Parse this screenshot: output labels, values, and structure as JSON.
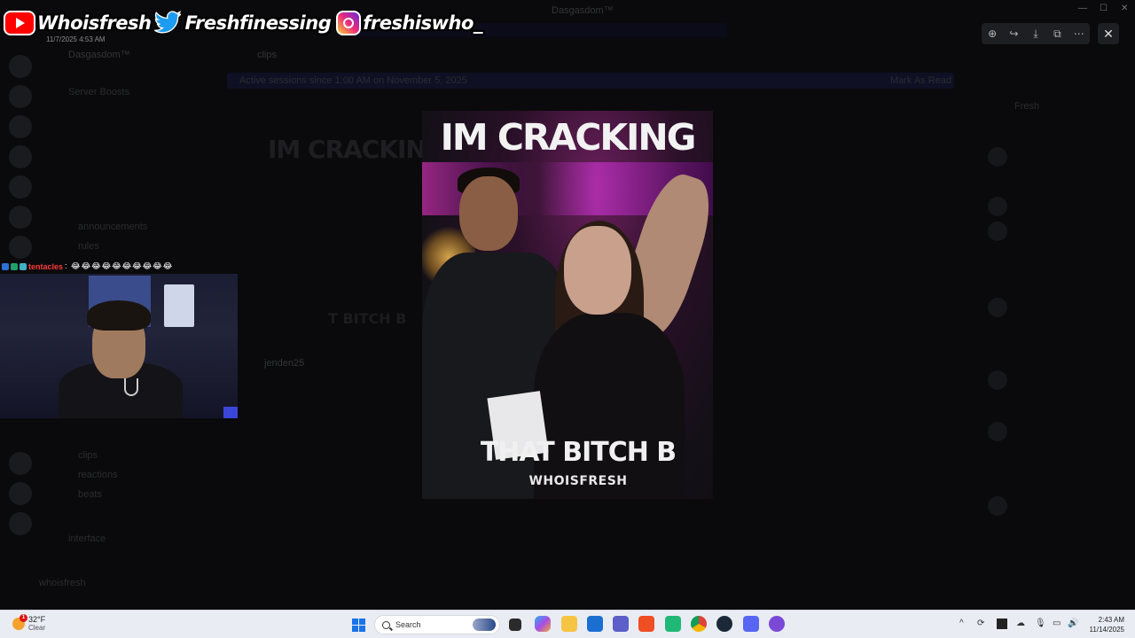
{
  "social_header": {
    "youtube_handle": "Whoisfresh",
    "twitter_handle": "Freshfinessing",
    "instagram_handle": "freshiswho_",
    "timestamp": "11/7/2025 4:53 AM"
  },
  "background": {
    "app_title": "Dasgasdom™",
    "server_name": "Dasgasdom™",
    "channel_name": "clips",
    "channels": [
      "Server Boosts",
      "announcements",
      "rules",
      "clips",
      "reactions",
      "beats",
      "interface"
    ],
    "banner_text": "Active sessions since 1:00 AM on November 5, 2025",
    "banner_action": "Mark As Read",
    "member_name": "Fresh",
    "user_label": "whoisfresh"
  },
  "stream_chat": {
    "username": "tentacles",
    "message": "😂😂😂😂😂😂😂😂😂😂"
  },
  "media_viewer": {
    "caption_top": "IM CRACKING",
    "caption_bottom": "THAT BITCH B",
    "watermark": "WHOISFRESH",
    "toolbar_icons": [
      "zoom-icon",
      "forward-icon",
      "download-icon",
      "open-external-icon",
      "more-icon"
    ],
    "close_icon": "close-icon"
  },
  "ghost_embed": {
    "title": "IM CRACKING",
    "subtitle": "T BITCH B",
    "author": "jenden25"
  },
  "taskbar": {
    "weather_temp": "32°F",
    "weather_condition": "Clear",
    "weather_alert": "1",
    "search_placeholder": "Search",
    "clock_time": "2:43 AM",
    "clock_date": "11/14/2025",
    "apps": [
      "file-explorer-icon",
      "copilot-icon",
      "folder-icon",
      "store-icon",
      "teams-icon",
      "brave-icon",
      "app-icon",
      "chrome-icon",
      "steam-icon",
      "discord-icon",
      "app-circle-icon"
    ],
    "colors": {
      "start": "#1a73e8",
      "taskbar_bg": "#e9ecf3"
    }
  }
}
